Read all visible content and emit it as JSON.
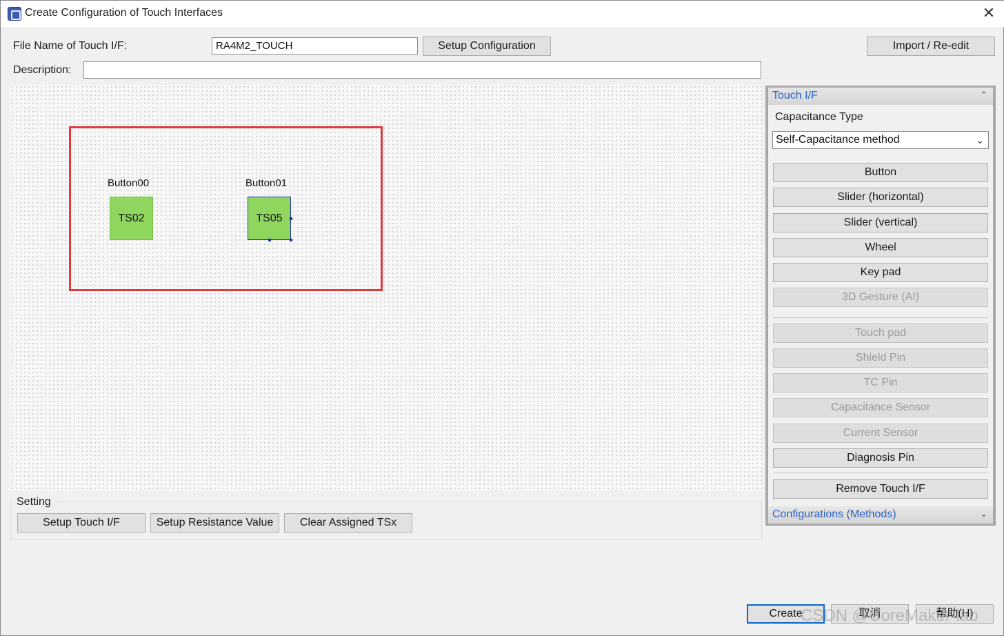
{
  "window": {
    "title": "Create Configuration of Touch Interfaces",
    "close_glyph": "✕"
  },
  "form": {
    "file_name_label": "File Name of Touch I/F:",
    "file_name_value": "RA4M2_TOUCH",
    "setup_config_label": "Setup Configuration",
    "import_label": "Import / Re-edit",
    "description_label": "Description:",
    "description_value": ""
  },
  "canvas": {
    "buttons": [
      {
        "name": "Button00",
        "sensor": "TS02"
      },
      {
        "name": "Button01",
        "sensor": "TS05"
      }
    ],
    "highlight_color": "#e0393e",
    "sensor_color": "#8ed65e"
  },
  "setting": {
    "title": "Setting",
    "buttons": [
      "Setup Touch I/F",
      "Setup Resistance Value",
      "Clear Assigned TSx"
    ]
  },
  "panel": {
    "touch_header": "Touch I/F",
    "capacitance_label": "Capacitance Type",
    "capacitance_value": "Self-Capacitance method",
    "items": [
      {
        "label": "Button",
        "enabled": true
      },
      {
        "label": "Slider (horizontal)",
        "enabled": true
      },
      {
        "label": "Slider (vertical)",
        "enabled": true
      },
      {
        "label": "Wheel",
        "enabled": true
      },
      {
        "label": "Key pad",
        "enabled": true
      },
      {
        "label": "3D Gesture (AI)",
        "enabled": false
      },
      {
        "label": "Touch pad",
        "enabled": false
      },
      {
        "label": "Shield Pin",
        "enabled": false
      },
      {
        "label": "TC Pin",
        "enabled": false
      },
      {
        "label": "Capacitance Sensor",
        "enabled": false
      },
      {
        "label": "Current Sensor",
        "enabled": false
      },
      {
        "label": "Diagnosis Pin",
        "enabled": true
      },
      {
        "label": "Remove Touch I/F",
        "enabled": true
      }
    ],
    "configs_header": "Configurations (Methods)",
    "collapse_glyph": "⌃",
    "expand_glyph": "⌄"
  },
  "footer": {
    "create_label": "Create",
    "cancel_label": "取消",
    "help_label": "帮助(H)"
  },
  "watermark": "CSDN @CoreMaker-lab"
}
